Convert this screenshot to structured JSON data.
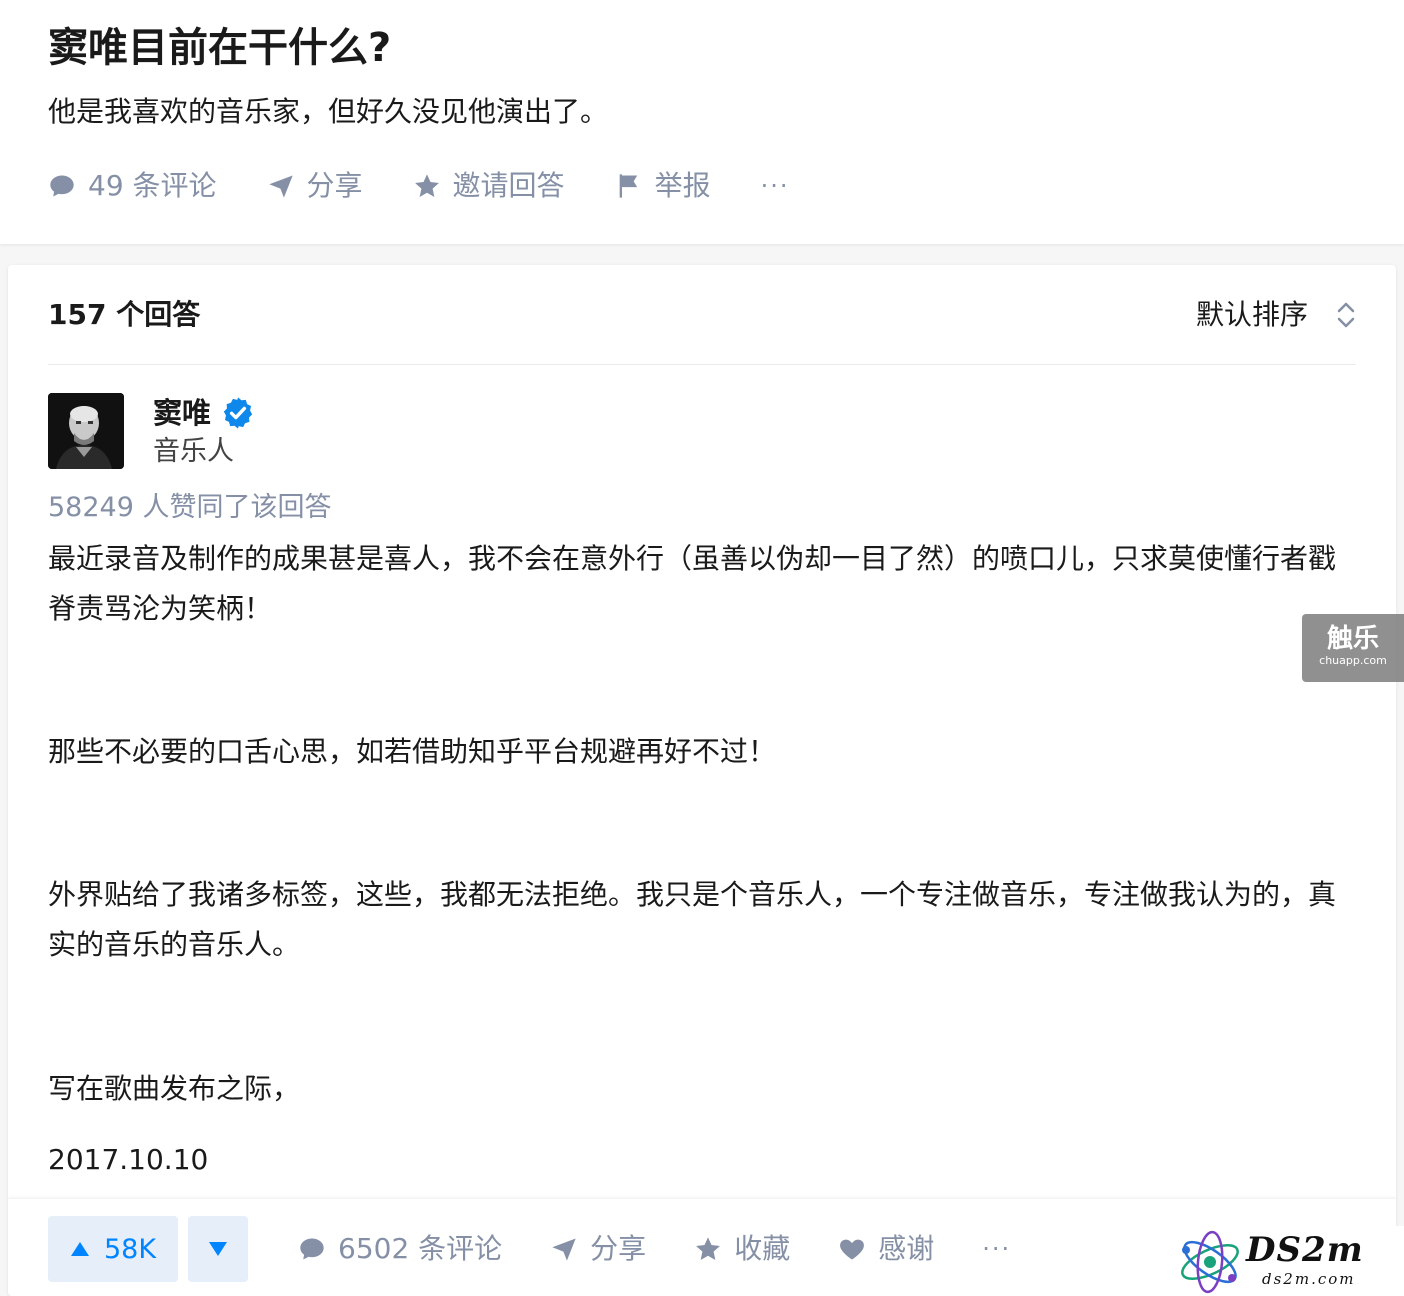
{
  "question": {
    "title": "窦唯目前在干什么?",
    "description": "他是我喜欢的音乐家，但好久没见他演出了。",
    "actions": {
      "comments": "49 条评论",
      "share": "分享",
      "invite": "邀请回答",
      "report": "举报",
      "more": "···"
    }
  },
  "answers": {
    "count": "157 个回答",
    "sort_label": "默认排序"
  },
  "answer": {
    "author_name": "窦唯",
    "author_verified": true,
    "author_headline": "音乐人",
    "votes_text": "58249 人赞同了该回答",
    "paragraphs": [
      "最近录音及制作的成果甚是喜人，我不会在意外行（虽善以伪却一目了然）的喷口儿，只求莫使懂行者戳脊责骂沦为笑柄！",
      "那些不必要的口舌心思，如若借助知乎平台规避再好不过！",
      "外界贴给了我诸多标签，这些，我都无法拒绝。我只是个音乐人，一个专注做音乐，专注做我认为的，真实的音乐的音乐人。",
      "写在歌曲发布之际，",
      "2017.10.10"
    ]
  },
  "bottom_bar": {
    "upvote_count": "58K",
    "comments": "6502 条评论",
    "share": "分享",
    "collect": "收藏",
    "thanks": "感谢",
    "more": "···"
  },
  "watermarks": {
    "chuapp_big": "触乐",
    "chuapp_small": "chuapp.com",
    "ds2m_main": "DS2m",
    "ds2m_sub": "ds2m.com"
  },
  "colors": {
    "accent": "#0084ff",
    "muted": "#8590a6",
    "vote_bg": "#e5eef9",
    "verified": "#0f88eb"
  }
}
